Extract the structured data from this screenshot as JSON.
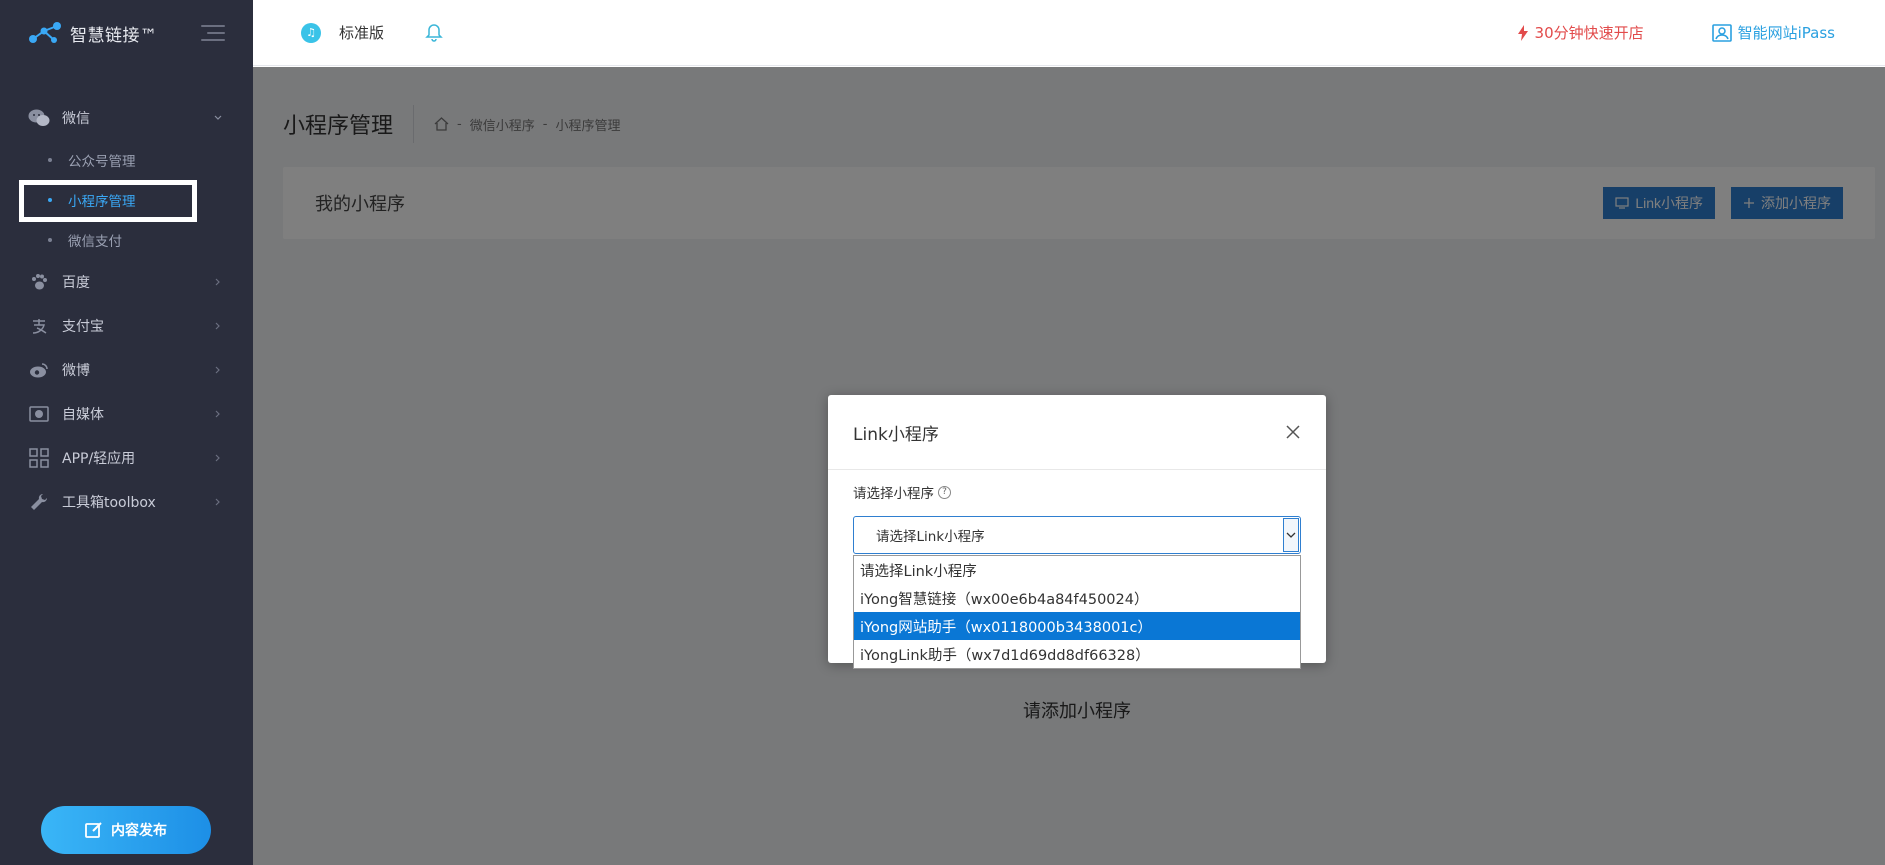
{
  "brand": {
    "name": "智慧链接™"
  },
  "sidebar": {
    "groups": [
      {
        "label": "微信",
        "icon": "wechat-icon",
        "expanded": true,
        "children": [
          {
            "label": "公众号管理",
            "active": false
          },
          {
            "label": "小程序管理",
            "active": true
          },
          {
            "label": "微信支付",
            "active": false
          }
        ]
      },
      {
        "label": "百度",
        "icon": "paw-icon"
      },
      {
        "label": "支付宝",
        "icon": "alipay-icon"
      },
      {
        "label": "微博",
        "icon": "weibo-icon"
      },
      {
        "label": "自媒体",
        "icon": "media-icon"
      },
      {
        "label": "APP/轻应用",
        "icon": "apps-icon"
      },
      {
        "label": "工具箱toolbox",
        "icon": "wrench-icon"
      }
    ],
    "publish_label": "内容发布"
  },
  "header": {
    "edition": "标准版",
    "quick_open": "30分钟快速开店",
    "ipass": "智能网站iPass"
  },
  "page": {
    "title": "小程序管理",
    "breadcrumb": [
      "微信小程序",
      "小程序管理"
    ],
    "card_title": "我的小程序",
    "link_button": "Link小程序",
    "add_button": "添加小程序",
    "empty_text": "请添加小程序"
  },
  "modal": {
    "title": "Link小程序",
    "field_label": "请选择小程序",
    "select_value": "请选择Link小程序",
    "options": [
      "请选择Link小程序",
      "iYong智慧链接（wx00e6b4a84f450024）",
      "iYong网站助手（wx0118000b3438001c）",
      "iYongLink助手（wx7d1d69dd8df66328）"
    ],
    "selected_index": 2
  },
  "colors": {
    "sidebar_bg": "#2b2e3d",
    "accent": "#2f7fd0",
    "active_link": "#3aa8f5",
    "quick_red": "#e24b4b",
    "option_highlight": "#0a77d5"
  }
}
